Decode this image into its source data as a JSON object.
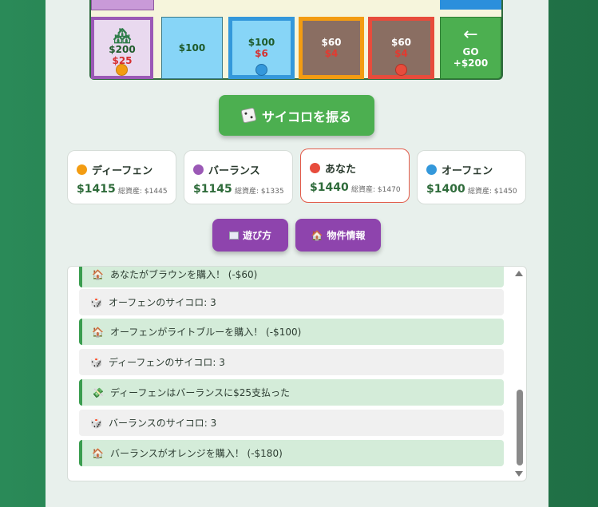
{
  "board": {
    "cells": [
      {
        "price": "$200",
        "rent": "$25",
        "icon": "house-icon"
      },
      {
        "price": "$100",
        "rent": ""
      },
      {
        "price": "$100",
        "rent": "$6"
      },
      {
        "price": "$60",
        "rent": "$4"
      },
      {
        "price": "$60",
        "rent": "$4"
      }
    ],
    "go": {
      "arrow": "←",
      "label": "GO",
      "bonus": "+$200"
    }
  },
  "dice_button": {
    "label": "サイコロを振る",
    "icon": "dice-icon"
  },
  "players": [
    {
      "name": "ディーフェン",
      "cash": "$1415",
      "net_label": "総資産:",
      "net": "$1445",
      "color": "#f39c12"
    },
    {
      "name": "バーランス",
      "cash": "$1145",
      "net_label": "総資産:",
      "net": "$1335",
      "color": "#9b59b6"
    },
    {
      "name": "あなた",
      "cash": "$1440",
      "net_label": "総資産:",
      "net": "$1470",
      "color": "#e74c3c"
    },
    {
      "name": "オーフェン",
      "cash": "$1400",
      "net_label": "総資産:",
      "net": "$1450",
      "color": "#3498db"
    }
  ],
  "buttons": {
    "how_to_play": "遊び方",
    "property_info": "物件情報"
  },
  "log": [
    {
      "type": "buy",
      "icon": "🏠",
      "text": "あなたがブラウンを購入！ (-$60)"
    },
    {
      "type": "roll",
      "icon": "🎲",
      "text": "オーフェンのサイコロ: 3"
    },
    {
      "type": "buy",
      "icon": "🏠",
      "text": "オーフェンがライトブルーを購入！ (-$100)"
    },
    {
      "type": "roll",
      "icon": "🎲",
      "text": "ディーフェンのサイコロ: 3"
    },
    {
      "type": "buy",
      "icon": "💸",
      "text": "ディーフェンはバーランスに$25支払った"
    },
    {
      "type": "roll",
      "icon": "🎲",
      "text": "バーランスのサイコロ: 3"
    },
    {
      "type": "buy",
      "icon": "🏠",
      "text": "バーランスがオレンジを購入！ (-$180)"
    }
  ]
}
